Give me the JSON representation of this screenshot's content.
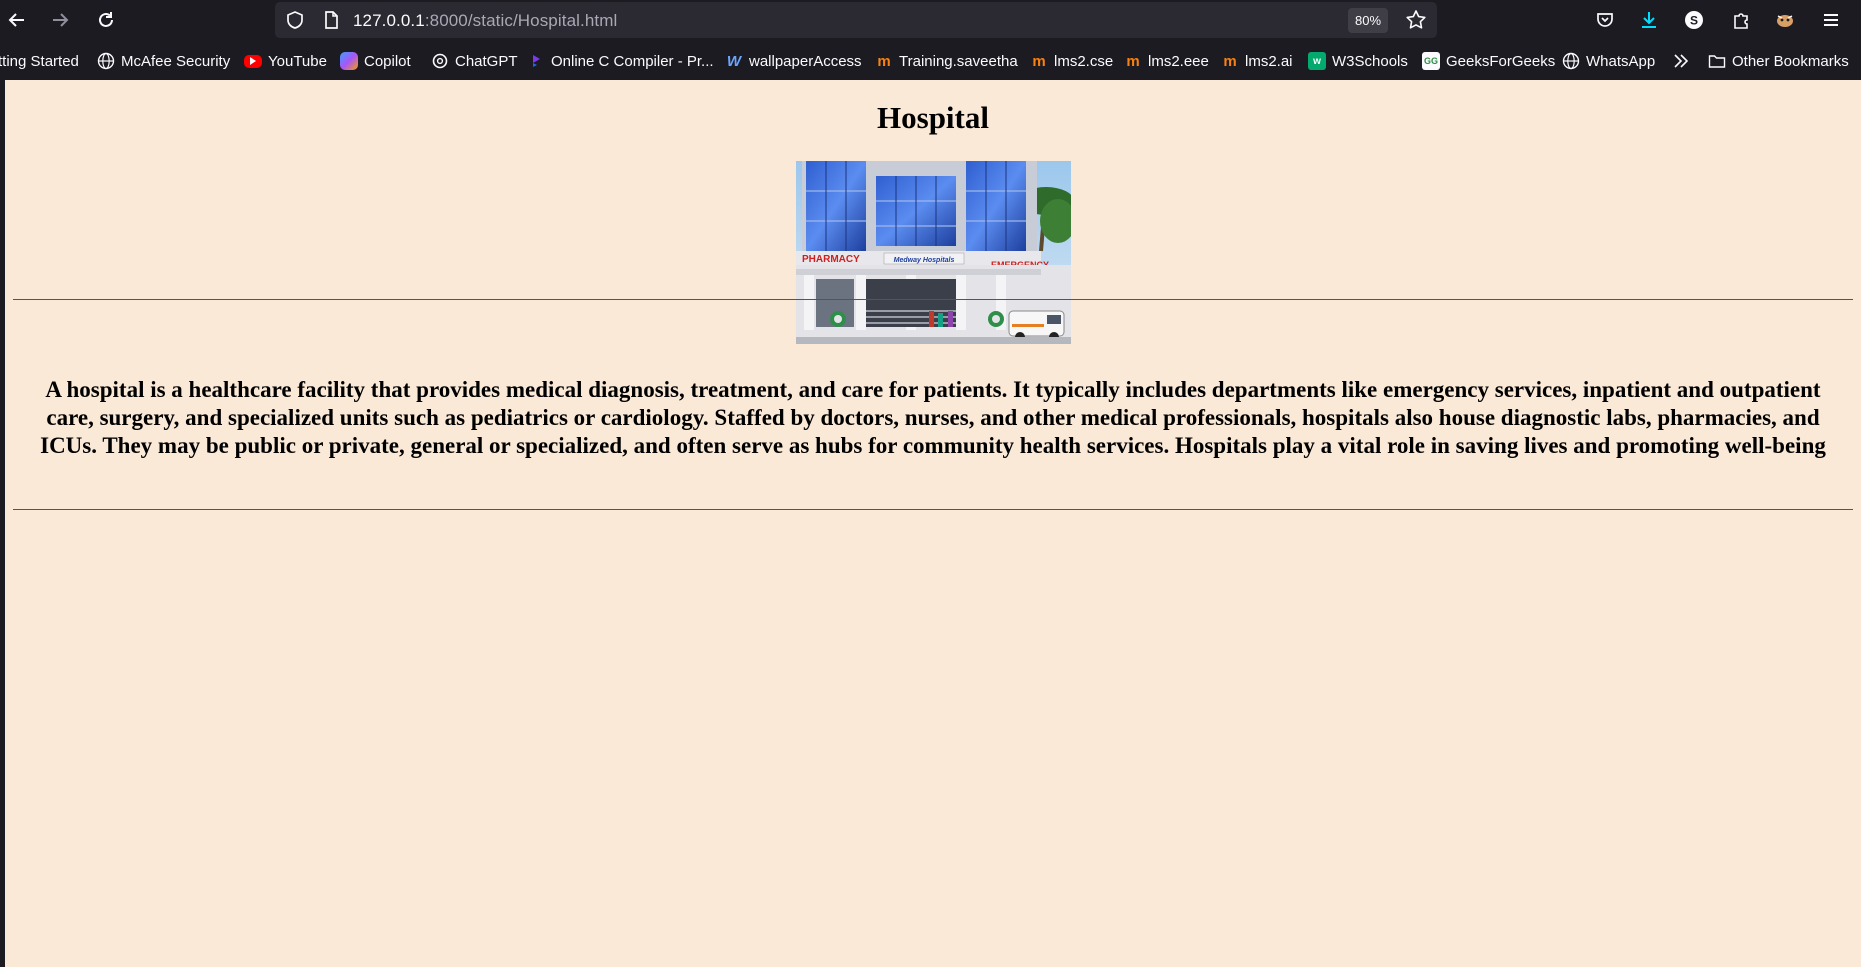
{
  "browser": {
    "url_host": "127.0.0.1",
    "url_path": ":8000/static/Hospital.html",
    "zoom": "80%"
  },
  "bookmarks": [
    {
      "label": "tting Started",
      "icon": "none"
    },
    {
      "label": "McAfee Security",
      "icon": "globe-icon"
    },
    {
      "label": "YouTube",
      "icon": "youtube-icon"
    },
    {
      "label": "Copilot",
      "icon": "copilot-icon"
    },
    {
      "label": "ChatGPT",
      "icon": "chatgpt-icon"
    },
    {
      "label": "Online C Compiler - Pr...",
      "icon": "compiler-icon"
    },
    {
      "label": "wallpaperAccess",
      "icon": "wallpaper-icon"
    },
    {
      "label": "Training.saveetha",
      "icon": "moodle-icon"
    },
    {
      "label": "lms2.cse",
      "icon": "moodle-icon"
    },
    {
      "label": "lms2.eee",
      "icon": "moodle-icon"
    },
    {
      "label": "lms2.ai",
      "icon": "moodle-icon"
    },
    {
      "label": "W3Schools",
      "icon": "w3schools-icon"
    },
    {
      "label": "GeeksForGeeks",
      "icon": "gfg-icon"
    },
    {
      "label": "WhatsApp",
      "icon": "globe-icon"
    },
    {
      "label": "Other Bookmarks",
      "icon": "folder-icon"
    }
  ],
  "page": {
    "title": "Hospital",
    "image_sign_left": "PHARMACY",
    "image_sign_center": "Medway Hospitals",
    "image_sign_right": "EMERGENCY",
    "description": "A hospital is a healthcare facility that provides medical diagnosis, treatment, and care for patients. It typically includes departments like emergency services, inpatient and outpatient care, surgery, and specialized units such as pediatrics or cardiology. Staffed by doctors, nurses, and other medical professionals, hospitals also house diagnostic labs, pharmacies, and ICUs. They may be public or private, general or specialized, and often serve as hubs for community health services. Hospitals play a vital role in saving lives and promoting well-being"
  },
  "colors": {
    "page_background": "#fae9d7",
    "chrome_background": "#1c1b22",
    "urlbar_background": "#2b2a33",
    "download_accent": "#00ddff"
  }
}
